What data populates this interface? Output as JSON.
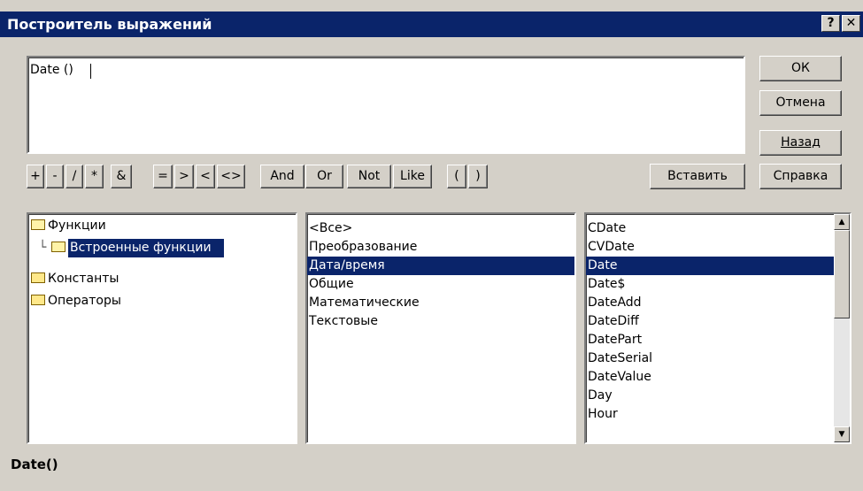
{
  "window": {
    "title": "Построитель выражений",
    "help_button": "?",
    "close_button": "✕"
  },
  "expression": {
    "value": "Date () "
  },
  "buttons": {
    "ok": "ОК",
    "cancel": "Отмена",
    "back": "Назад",
    "insert": "Вставить",
    "help": "Справка"
  },
  "operators": [
    "+",
    "-",
    "/",
    "*",
    "&",
    "=",
    ">",
    "<",
    "<>",
    "And",
    "Or",
    "Not",
    "Like",
    "(",
    ")"
  ],
  "tree": {
    "root": "Функции",
    "child": "Встроенные функции",
    "constants": "Константы",
    "operators": "Операторы"
  },
  "categories": {
    "items": [
      "<Все>",
      "Преобразование",
      "Дата/время",
      "Общие",
      "Математические",
      "Текстовые"
    ],
    "selected": "Дата/время"
  },
  "functions": {
    "items": [
      "CDate",
      "CVDate",
      "Date",
      "Date$",
      "DateAdd",
      "DateDiff",
      "DatePart",
      "DateSerial",
      "DateValue",
      "Day",
      "Hour"
    ],
    "selected": "Date"
  },
  "status": {
    "text": "Date()"
  },
  "colors": {
    "titlebar": "#0a246a",
    "face": "#d4d0c8",
    "selection": "#0a246a"
  }
}
